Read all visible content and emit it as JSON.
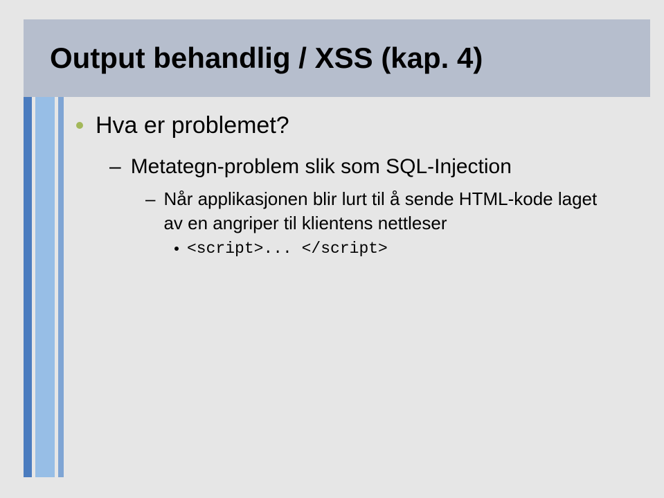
{
  "title": "Output behandlig / XSS (kap. 4)",
  "bullets": {
    "lvl1": "Hva er problemet?",
    "lvl2": "Metategn-problem slik som SQL-Injection",
    "lvl3": "Når applikasjonen blir lurt til å sende HTML-kode laget av en angriper til klientens nettleser",
    "lvl4": "<script>... </script>"
  }
}
